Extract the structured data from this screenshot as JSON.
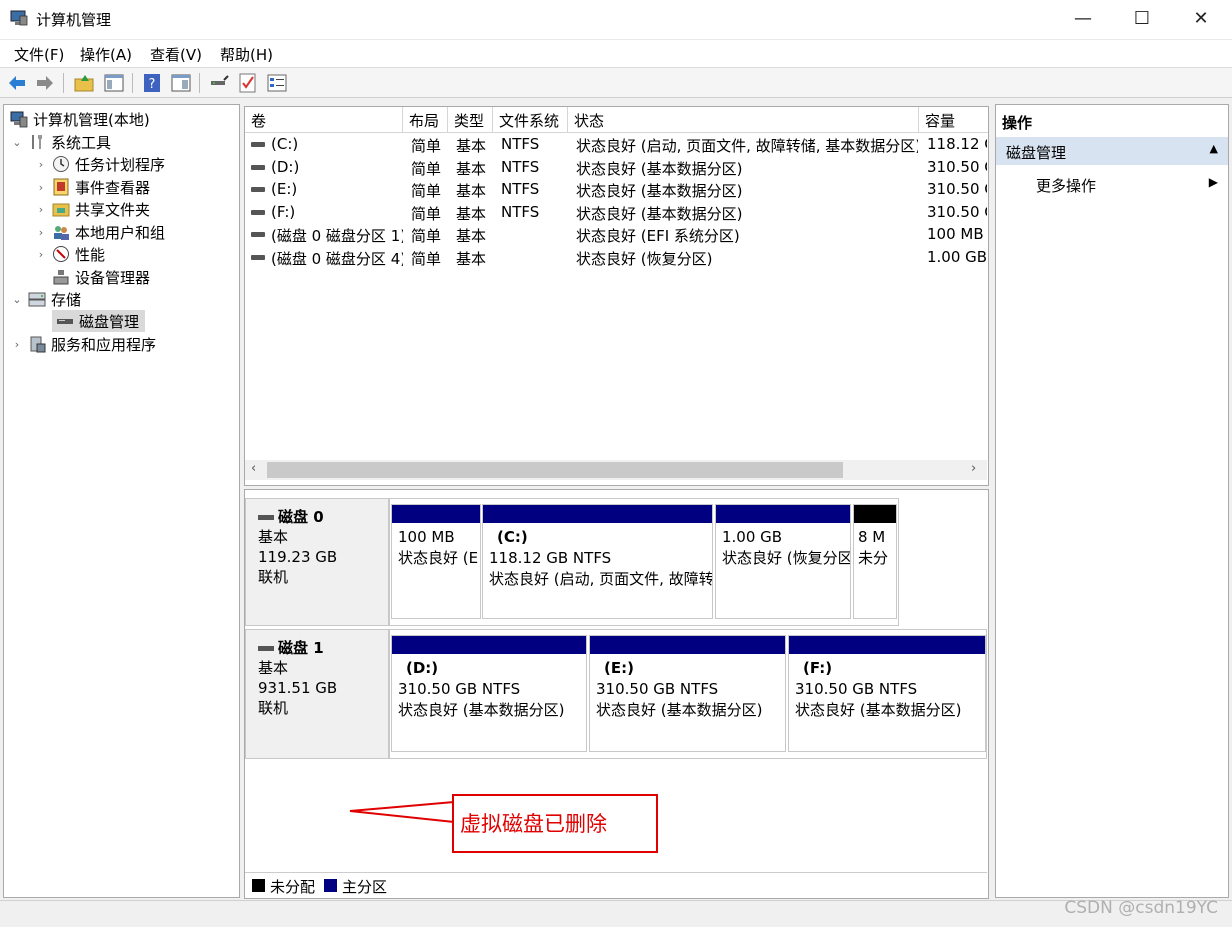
{
  "window": {
    "title": "计算机管理",
    "minimize": "—",
    "maximize": "☐",
    "close": "✕"
  },
  "menu": [
    "文件(F)",
    "操作(A)",
    "查看(V)",
    "帮助(H)"
  ],
  "toolbar_icons": [
    "back-arrow-icon",
    "forward-arrow-icon",
    "up-folder-icon",
    "show-hide-tree-icon",
    "help-icon",
    "console-icon",
    "connect-icon",
    "checkmark-icon",
    "properties-list-icon"
  ],
  "tree": {
    "root": "计算机管理(本地)",
    "system_tools": "系统工具",
    "task_scheduler": "任务计划程序",
    "event_viewer": "事件查看器",
    "shared_folders": "共享文件夹",
    "local_users": "本地用户和组",
    "performance": "性能",
    "device_manager": "设备管理器",
    "storage": "存储",
    "disk_management": "磁盘管理",
    "services_apps": "服务和应用程序"
  },
  "volume_table": {
    "headers": [
      "卷",
      "布局",
      "类型",
      "文件系统",
      "状态",
      "容量"
    ],
    "rows": [
      {
        "vol": "(C:)",
        "layout": "简单",
        "type": "基本",
        "fs": "NTFS",
        "status": "状态良好 (启动, 页面文件, 故障转储, 基本数据分区)",
        "cap": "118.12 G"
      },
      {
        "vol": "(D:)",
        "layout": "简单",
        "type": "基本",
        "fs": "NTFS",
        "status": "状态良好 (基本数据分区)",
        "cap": "310.50 G"
      },
      {
        "vol": "(E:)",
        "layout": "简单",
        "type": "基本",
        "fs": "NTFS",
        "status": "状态良好 (基本数据分区)",
        "cap": "310.50 G"
      },
      {
        "vol": "(F:)",
        "layout": "简单",
        "type": "基本",
        "fs": "NTFS",
        "status": "状态良好 (基本数据分区)",
        "cap": "310.50 G"
      },
      {
        "vol": "(磁盘 0 磁盘分区 1)",
        "layout": "简单",
        "type": "基本",
        "fs": "",
        "status": "状态良好 (EFI 系统分区)",
        "cap": "100 MB"
      },
      {
        "vol": "(磁盘 0 磁盘分区 4)",
        "layout": "简单",
        "type": "基本",
        "fs": "",
        "status": "状态良好 (恢复分区)",
        "cap": "1.00 GB"
      }
    ]
  },
  "disks": [
    {
      "name": "磁盘 0",
      "kind": "基本",
      "size": "119.23 GB",
      "state": "联机",
      "partitions": [
        {
          "title": "",
          "line1": "100 MB",
          "line2": "状态良好 (E"
        },
        {
          "title": "(C:)",
          "line1": "118.12 GB NTFS",
          "line2": "状态良好 (启动, 页面文件, 故障转"
        },
        {
          "title": "",
          "line1": "1.00 GB",
          "line2": "状态良好 (恢复分区"
        },
        {
          "title": "",
          "line1": "8 M",
          "line2": "未分"
        }
      ]
    },
    {
      "name": "磁盘 1",
      "kind": "基本",
      "size": "931.51 GB",
      "state": "联机",
      "partitions": [
        {
          "title": "(D:)",
          "line1": "310.50 GB NTFS",
          "line2": "状态良好 (基本数据分区)"
        },
        {
          "title": "(E:)",
          "line1": "310.50 GB NTFS",
          "line2": "状态良好 (基本数据分区)"
        },
        {
          "title": "(F:)",
          "line1": "310.50 GB NTFS",
          "line2": "状态良好 (基本数据分区)"
        }
      ]
    }
  ],
  "legend": {
    "unallocated": "未分配",
    "primary": "主分区"
  },
  "colors": {
    "primary": "#000080",
    "unallocated": "#000000",
    "callout": "#e00000",
    "selection": "#d8e3f1"
  },
  "callout": "虚拟磁盘已删除",
  "actions": {
    "title": "操作",
    "section": "磁盘管理",
    "more": "更多操作"
  },
  "watermark": "CSDN @csdn19YC"
}
